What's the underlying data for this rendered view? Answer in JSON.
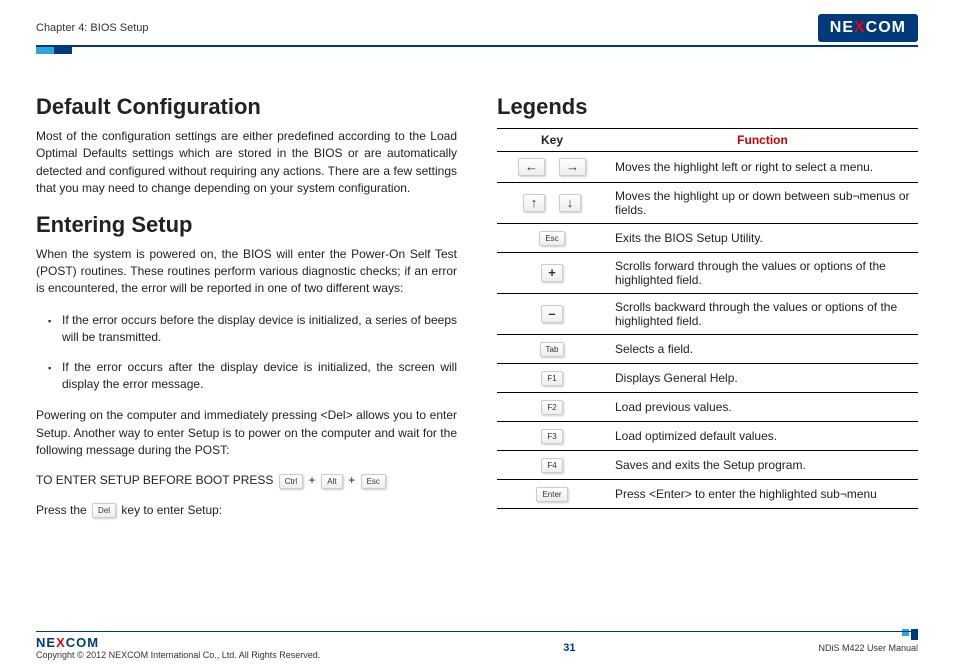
{
  "header": {
    "chapter": "Chapter 4: BIOS Setup",
    "brand_pre": "NE",
    "brand_x": "X",
    "brand_post": "COM"
  },
  "left": {
    "h1a": "Default Configuration",
    "p1": "Most of the configuration settings are either predefined according to the Load Optimal Defaults settings which are stored in the BIOS or are automatically detected and configured without requiring any actions. There are a few settings that you may need to change depending on your system configuration.",
    "h1b": "Entering Setup",
    "p2": "When the system is powered on, the BIOS will enter the Power-On Self Test (POST) routines. These routines perform various diagnostic checks; if an error is encountered, the error will be reported in one of two different ways:",
    "li1": "If the error occurs before the display device is initialized, a series of beeps will be transmitted.",
    "li2": "If the error occurs after the display device is initialized, the screen will display the error message.",
    "p3": "Powering on the computer and immediately pressing <Del> allows you to enter Setup. Another way to enter Setup is to power on the computer and wait for the following message during the POST:",
    "setup_prefix": "TO ENTER SETUP BEFORE BOOT PRESS",
    "k_ctrl": "Ctrl",
    "k_alt": "Alt",
    "k_esc": "Esc",
    "plus": "+",
    "press_prefix": "Press the",
    "k_del": "Del",
    "press_suffix": "key to enter Setup:"
  },
  "right": {
    "h1": "Legends",
    "th_key": "Key",
    "th_func": "Function",
    "rows": [
      {
        "keys": [
          "←",
          "→"
        ],
        "func": "Moves the highlight left or right to select a menu."
      },
      {
        "keys": [
          "↑",
          "↓"
        ],
        "func": "Moves the highlight up or down between sub¬menus or fields."
      },
      {
        "keys": [
          "Esc"
        ],
        "func": "Exits the BIOS Setup Utility."
      },
      {
        "keys": [
          "+"
        ],
        "func": "Scrolls forward through the values or options of the highlighted field."
      },
      {
        "keys": [
          "–"
        ],
        "func": "Scrolls backward through the values or options of the highlighted field."
      },
      {
        "keys": [
          "Tab"
        ],
        "func": "Selects a field."
      },
      {
        "keys": [
          "F1"
        ],
        "func": "Displays General Help."
      },
      {
        "keys": [
          "F2"
        ],
        "func": "Load previous values."
      },
      {
        "keys": [
          "F3"
        ],
        "func": "Load optimized default values."
      },
      {
        "keys": [
          "F4"
        ],
        "func": "Saves and exits the Setup program."
      },
      {
        "keys": [
          "Enter"
        ],
        "func": "Press <Enter> to enter the highlighted sub¬menu"
      }
    ]
  },
  "footer": {
    "brand_pre": "NE",
    "brand_x": "X",
    "brand_post": "COM",
    "copyright": "Copyright © 2012 NEXCOM International Co., Ltd. All Rights Reserved.",
    "page": "31",
    "manual": "NDiS M422 User Manual"
  }
}
